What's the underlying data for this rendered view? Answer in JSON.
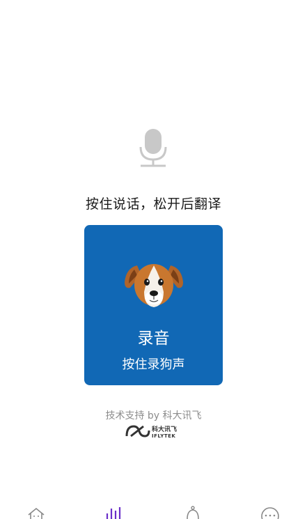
{
  "hint": "按住说话，松开后翻译",
  "record_card": {
    "title": "录音",
    "subtitle": "按住录狗声"
  },
  "support_text": "技术支持 by 科大讯飞",
  "logo": {
    "cn": "科大讯飞",
    "en": "IFLYTEK"
  },
  "colors": {
    "card": "#1168b5",
    "mic": "#c8c8c8",
    "active_tab": "#6a2fc8",
    "inactive_tab": "#888888"
  },
  "tabs": [
    {
      "icon": "home-icon",
      "active": false
    },
    {
      "icon": "sound-wave-icon",
      "active": true
    },
    {
      "icon": "bell-icon",
      "active": false
    },
    {
      "icon": "more-icon",
      "active": false
    }
  ]
}
